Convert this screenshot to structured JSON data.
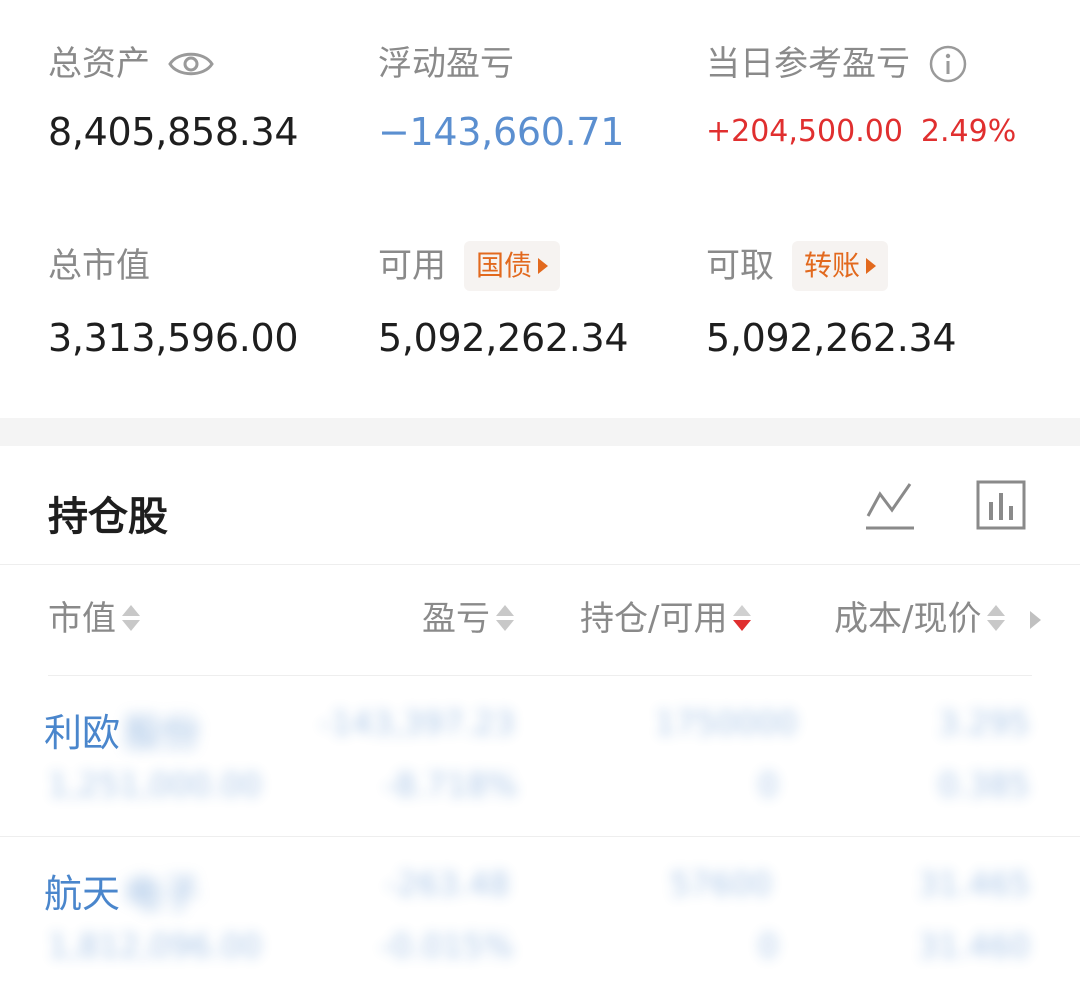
{
  "summary": {
    "total_assets_label": "总资产",
    "total_assets_value": "8,405,858.34",
    "floating_pl_label": "浮动盈亏",
    "floating_pl_value": "−143,660.71",
    "daily_pl_label": "当日参考盈亏",
    "daily_pl_value": "+204,500.00",
    "daily_pl_pct": "2.49%",
    "market_value_label": "总市值",
    "market_value_value": "3,313,596.00",
    "available_label": "可用",
    "available_tag": "国债",
    "available_value": "5,092,262.34",
    "withdrawable_label": "可取",
    "withdrawable_tag": "转账",
    "withdrawable_value": "5,092,262.34"
  },
  "holdings": {
    "title": "持仓股",
    "columns": [
      "市值",
      "盈亏",
      "持仓/可用",
      "成本/现价"
    ],
    "rows": [
      {
        "name": "利欧",
        "name_blurred": "股份",
        "b1": "-143,397.23",
        "b2": "1750000",
        "b3": "3.295",
        "b4": "1,251,000.00",
        "b5": "-8.718%",
        "b6": "0",
        "b7": "0.385"
      },
      {
        "name": "航天",
        "name_blurred": "电子",
        "b1": "-263.48",
        "b2": "57600",
        "b3": "31.465",
        "b4": "1,812,096.00",
        "b5": "-0.015%",
        "b6": "0",
        "b7": "31.460"
      }
    ]
  },
  "icons": {
    "eye": "eye-icon",
    "info": "info-icon",
    "line_chart": "line-chart-icon",
    "bar_chart": "bar-chart-icon"
  },
  "colors": {
    "negative": "#5b8fd0",
    "positive": "#e02f2f",
    "tag": "#e2691e"
  }
}
